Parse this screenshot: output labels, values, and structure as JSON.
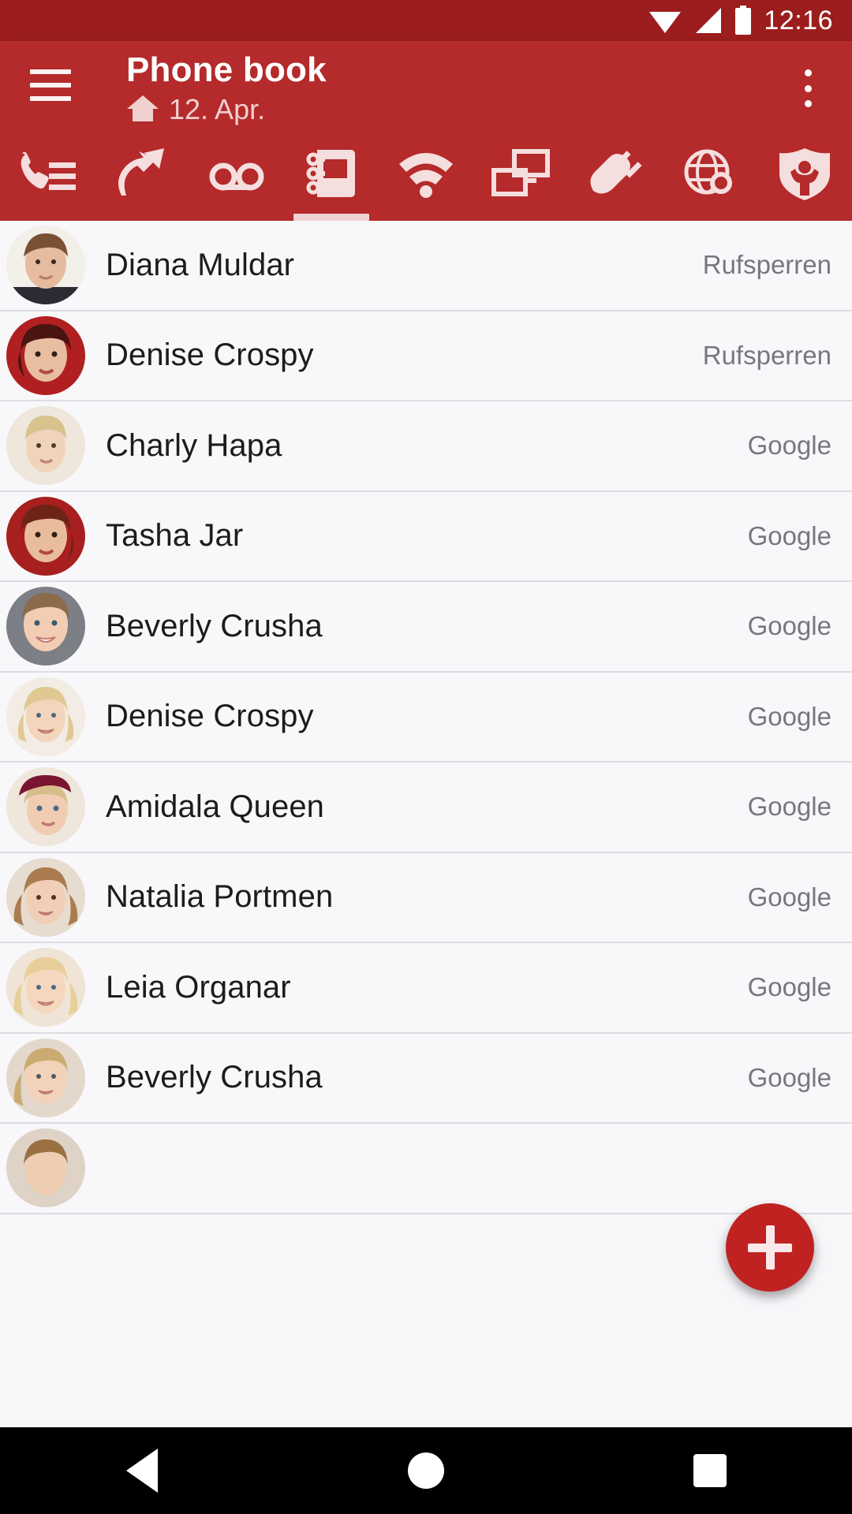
{
  "statusbar": {
    "time": "12:16",
    "icons": [
      "wifi-icon",
      "signal-icon",
      "battery-icon"
    ]
  },
  "appbar": {
    "menu_icon": "hamburger-menu-icon",
    "title": "Phone book",
    "subtitle": "12. Apr.",
    "subtitle_icon": "home-icon",
    "overflow_icon": "overflow-menu-icon",
    "background_color": "#b52a2a"
  },
  "tabs": [
    {
      "name": "call-list-tab",
      "icon": "phone-list-icon",
      "selected": false
    },
    {
      "name": "call-diversion-tab",
      "icon": "call-forward-arrow-icon",
      "selected": false
    },
    {
      "name": "answering-machine-tab",
      "icon": "voicemail-icon",
      "selected": false
    },
    {
      "name": "phone-book-tab",
      "icon": "address-book-icon",
      "selected": true
    },
    {
      "name": "wlan-tab",
      "icon": "wifi-icon",
      "selected": false
    },
    {
      "name": "network-tab",
      "icon": "devices-icon",
      "selected": false
    },
    {
      "name": "smart-home-tab",
      "icon": "power-plug-icon",
      "selected": false
    },
    {
      "name": "internet-tab",
      "icon": "globe-search-icon",
      "selected": false
    },
    {
      "name": "parental-control-tab",
      "icon": "shield-person-icon",
      "selected": false
    }
  ],
  "contacts": [
    {
      "name": "Diana Muldar",
      "source": "Rufsperren",
      "hair": "#7a5233",
      "skin": "#e6bb9e",
      "top": "#2b2b33"
    },
    {
      "name": "Denise Crospy",
      "source": "Rufsperren",
      "hair": "#4a1410",
      "skin": "#e8bda0",
      "top": "#b02020"
    },
    {
      "name": "Charly Hapa",
      "source": "Google",
      "hair": "#d8c28e",
      "skin": "#f0d3bb",
      "top": "#efe6dc"
    },
    {
      "name": "Tasha Jar",
      "source": "Google",
      "hair": "#6d2417",
      "skin": "#e9bc9c",
      "top": "#a81f1f"
    },
    {
      "name": "Beverly Crusha",
      "source": "Google",
      "hair": "#8b6b49",
      "skin": "#f2cdb4",
      "top": "#7d7f86"
    },
    {
      "name": "Denise Crospy",
      "source": "Google",
      "hair": "#e0c893",
      "skin": "#f3d5bb",
      "top": "#f2ece4"
    },
    {
      "name": "Amidala Queen",
      "source": "Google",
      "hair": "#d7bd8c",
      "skin": "#f0cdb2",
      "top": "#7a1430"
    },
    {
      "name": "Natalia Portmen",
      "source": "Google",
      "hair": "#a97b4e",
      "skin": "#f1cfb6",
      "top": "#e7dcd0"
    },
    {
      "name": "Leia Organar",
      "source": "Google",
      "hair": "#e8cf99",
      "skin": "#f4d7bd",
      "top": "#efe4d6"
    },
    {
      "name": "Beverly Crusha",
      "source": "Google",
      "hair": "#cbab72",
      "skin": "#f2d2b8",
      "top": "#e3d8cb"
    },
    {
      "name": "",
      "source": "",
      "hair": "#9a7043",
      "skin": "#eecdb2",
      "top": "#ded3c6"
    }
  ],
  "fab": {
    "name": "add-contact-button",
    "icon": "plus-icon",
    "color": "#c02222"
  },
  "navbar": {
    "back": "back-button",
    "home": "home-button",
    "recents": "recents-button"
  }
}
